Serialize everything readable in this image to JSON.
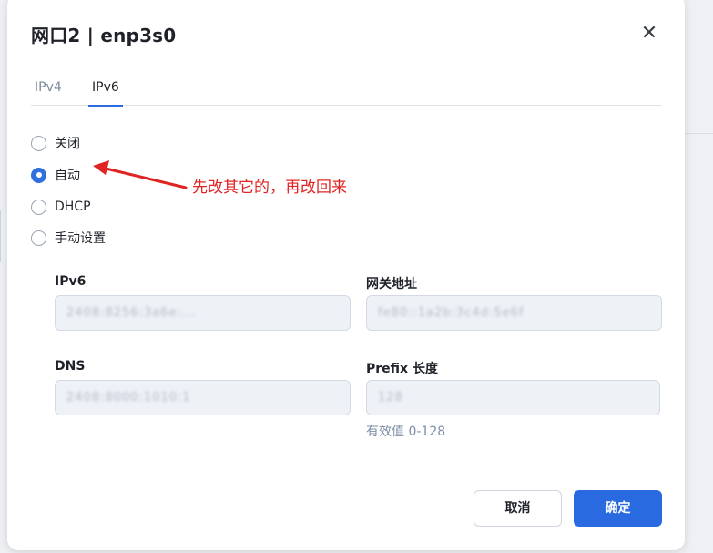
{
  "dialog": {
    "title": "网口2 | enp3s0",
    "close_icon": "close-icon"
  },
  "tabs": [
    {
      "label": "IPv4",
      "active": false
    },
    {
      "label": "IPv6",
      "active": true
    }
  ],
  "mode_options": [
    {
      "label": "关闭",
      "checked": false
    },
    {
      "label": "自动",
      "checked": true
    },
    {
      "label": "DHCP",
      "checked": false
    },
    {
      "label": "手动设置",
      "checked": false
    }
  ],
  "annotation": {
    "text": "先改其它的，再改回来",
    "color": "#e02424"
  },
  "fields": {
    "ipv6": {
      "label": "IPv6",
      "value": "2408:8256:3a6e:...",
      "placeholder": ""
    },
    "gateway": {
      "label": "网关地址",
      "value": "fe80::1a2b:3c4d:5e6f",
      "placeholder": ""
    },
    "dns": {
      "label": "DNS",
      "value": "2408:8000:1010:1",
      "placeholder": ""
    },
    "prefix": {
      "label": "Prefix 长度",
      "value": "128",
      "placeholder": "",
      "hint": "有效值 0-128"
    }
  },
  "buttons": {
    "cancel": "取消",
    "confirm": "确定"
  },
  "colors": {
    "accent": "#2a6ae0",
    "annotation": "#e02424"
  }
}
